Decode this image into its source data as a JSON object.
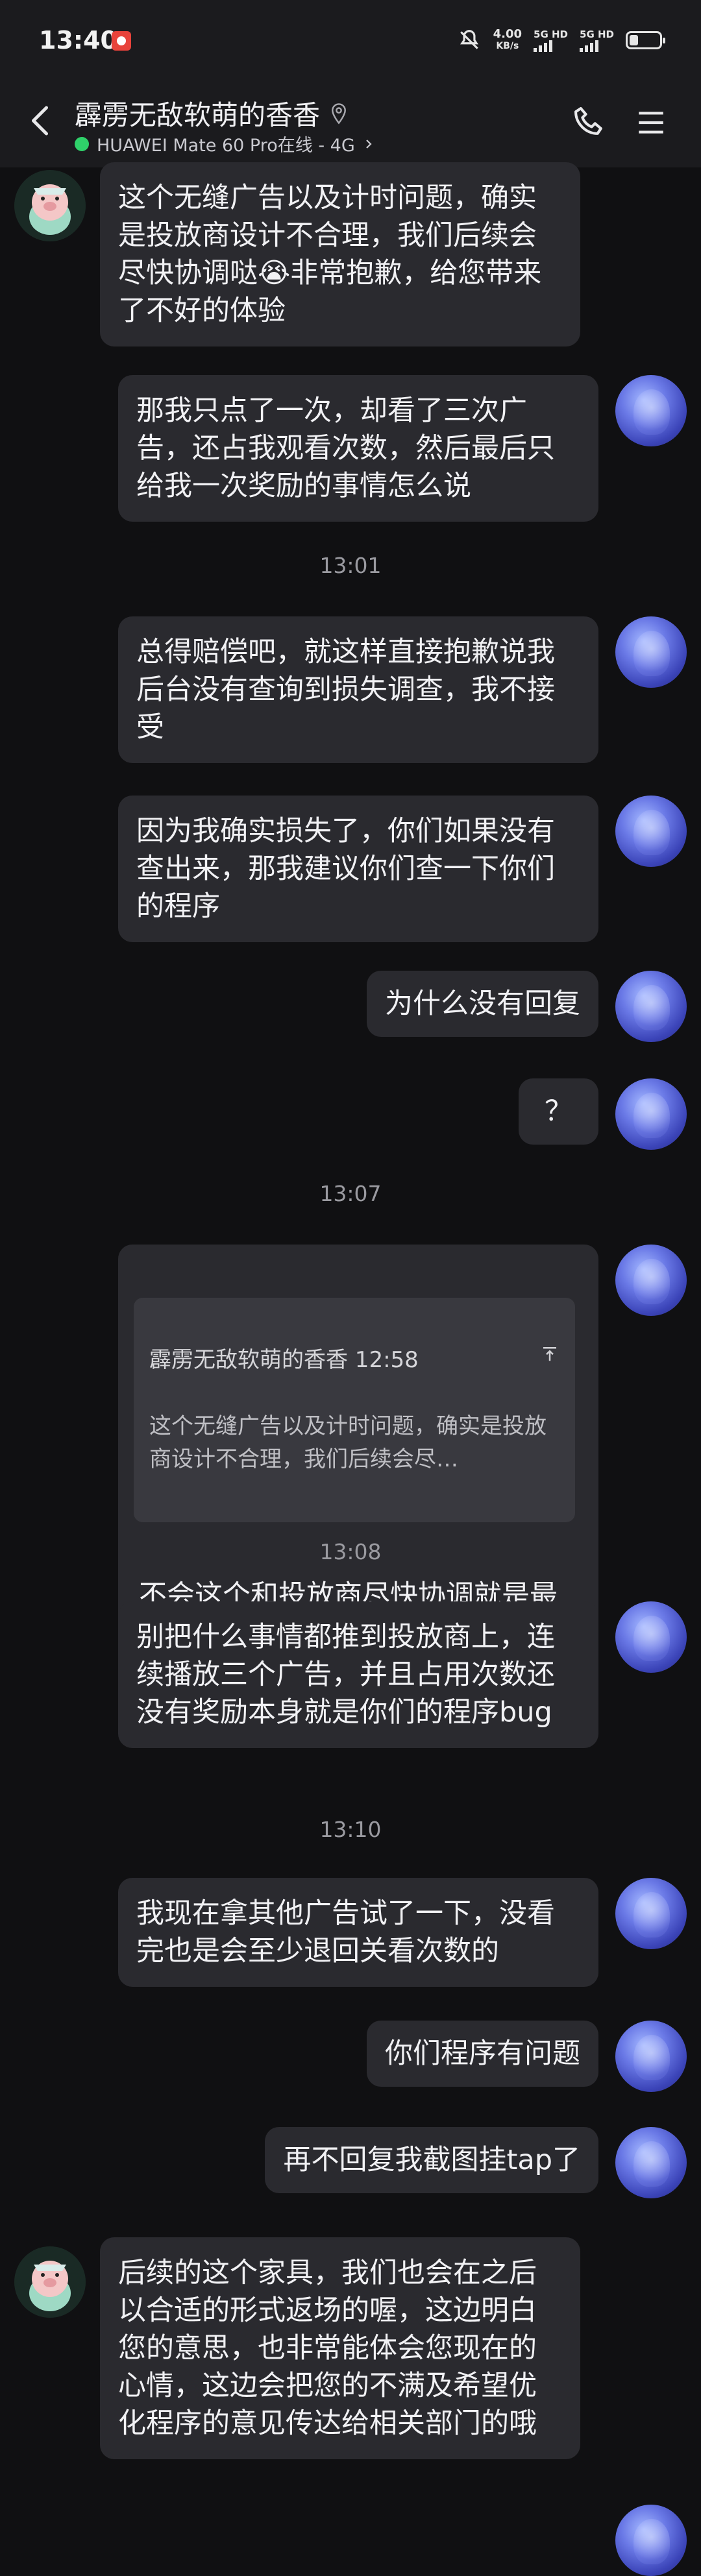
{
  "status_bar": {
    "time": "13:40",
    "net_speed_value": "4.00",
    "net_speed_unit": "KB/s",
    "sim1": "5G HD",
    "sim2": "5G HD"
  },
  "header": {
    "title": "霹雳无敌软萌的香香",
    "subtitle": "HUAWEI Mate 60 Pro在线 - 4G"
  },
  "messages": {
    "m1": "这个无缝广告以及计时问题，确实是投放商设计不合理，我们后续会尽快协调哒😭非常抱歉，给您带来了不好的体验",
    "m2": "那我只点了一次，却看了三次广告，还占我观看次数，然后最后只给我一次奖励的事情怎么说",
    "t1": "13:01",
    "m3": "总得赔偿吧，就这样直接抱歉说我后台没有查询到损失调查，我不接受",
    "m4": "因为我确实损失了，你们如果没有查出来，那我建议你们查一下你们的程序",
    "m5": "为什么没有回复",
    "m6": "？",
    "t2": "13:07",
    "quote_author": "霹雳无敌软萌的香香 12:58",
    "quote_text": "这个无缝广告以及计时问题，确实是投放商设计不合理，我们后续会尽…",
    "m7": "不会这个和投放商尽快协调就是最后回复了吧",
    "t3": "13:08",
    "m8": "别把什么事情都推到投放商上，连续播放三个广告，并且占用次数还没有奖励本身就是你们的程序bug",
    "t4": "13:10",
    "m9": "我现在拿其他广告试了一下，没看完也是会至少退回关看次数的",
    "m10": "你们程序有问题",
    "m11": "再不回复我截图挂tap了",
    "m12": "后续的这个家具，我们也会在之后以合适的形式返场的喔，这边明白您的意思，也非常能体会您现在的心情，这边会把您的不满及希望优化程序的意见传达给相关部门的哦"
  },
  "colors": {
    "background": "#101012",
    "bubble": "#2a2a2f",
    "online": "#2fd16a"
  }
}
